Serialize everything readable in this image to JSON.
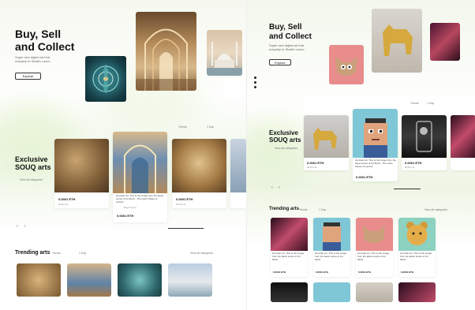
{
  "left": {
    "hero": {
      "title_line1": "Buy, Sell",
      "title_line2": "and Collect",
      "subtitle": "Super rare digital art that uniquely to Shaikh Lazzu",
      "explore_label": "Explore"
    },
    "exclusive": {
      "title_line1": "Exclusive",
      "title_line2": "SOUQ arts",
      "view_all": "View all categories",
      "filter_label": "Trends",
      "filter_period": "1 Day"
    },
    "cards": [
      {
        "price": "0.0001 ETH",
        "meta": "3d 8m 4s"
      },
      {
        "caption": "Gonzalo Art, This Is the image from the latest series of Art Mock - The Color Palete of Lazzus",
        "author": "Buyer Gonz",
        "price": "0.0001 ETH",
        "meta": "3d 8m 4s"
      },
      {
        "price": "0.0001 ETH",
        "meta": "3d 8m 4s"
      }
    ],
    "trending": {
      "title": "Trending arts",
      "filter_label": "Trends",
      "filter_period": "1 Day",
      "view_all": "View all categories"
    }
  },
  "right": {
    "hero": {
      "title_line1": "Buy, Sell",
      "title_line2": "and Collect",
      "subtitle": "Super rare digital art that uniquely to Shaikh Lazzu",
      "explore_label": "Explore"
    },
    "exclusive": {
      "title_line1": "Exclusive",
      "title_line2": "SOUQ arts",
      "view_all": "View all categories",
      "filter_label": "Trends",
      "filter_period": "1 Day"
    },
    "cards": [
      {
        "price": "0.0001 ETH",
        "meta": "3d 8m 4s"
      },
      {
        "caption": "Gonzalo Art, This Is the image from the latest series of Art Mock - The Color Palete of Lazzus",
        "author": "Buyer Gonz",
        "price": "0.0001 ETH",
        "meta": "3d 8m 4s"
      },
      {
        "price": "0.0001 ETH",
        "meta": "3d 8m 4s"
      }
    ],
    "trending": {
      "title": "Trending arts",
      "filter_label": "Trends",
      "filter_period": "1 Day",
      "view_all": "View all categories"
    },
    "trending_cards": [
      {
        "caption": "Gonzalo Art, This Is the image from the latest series of Art Mock",
        "price": "0.0001 ETH",
        "meta": "3d 8m 4s"
      },
      {
        "caption": "Gonzalo Art, This Is the image from the latest series of Art Mock",
        "price": "0.0001 ETH",
        "meta": "3d 8m 4s"
      },
      {
        "caption": "Gonzalo Art, This Is the image from the latest series of Art Mock",
        "price": "0.0001 ETH",
        "meta": "3d 8m 4s"
      },
      {
        "caption": "Gonzalo Art, This Is the image from the latest series of Art Mock",
        "price": "0.0001 ETH",
        "meta": "3d 8m 4s"
      }
    ]
  },
  "colors": {
    "accent_green": "#d8ebc4",
    "text_dark": "#111111",
    "muted": "#777777"
  }
}
